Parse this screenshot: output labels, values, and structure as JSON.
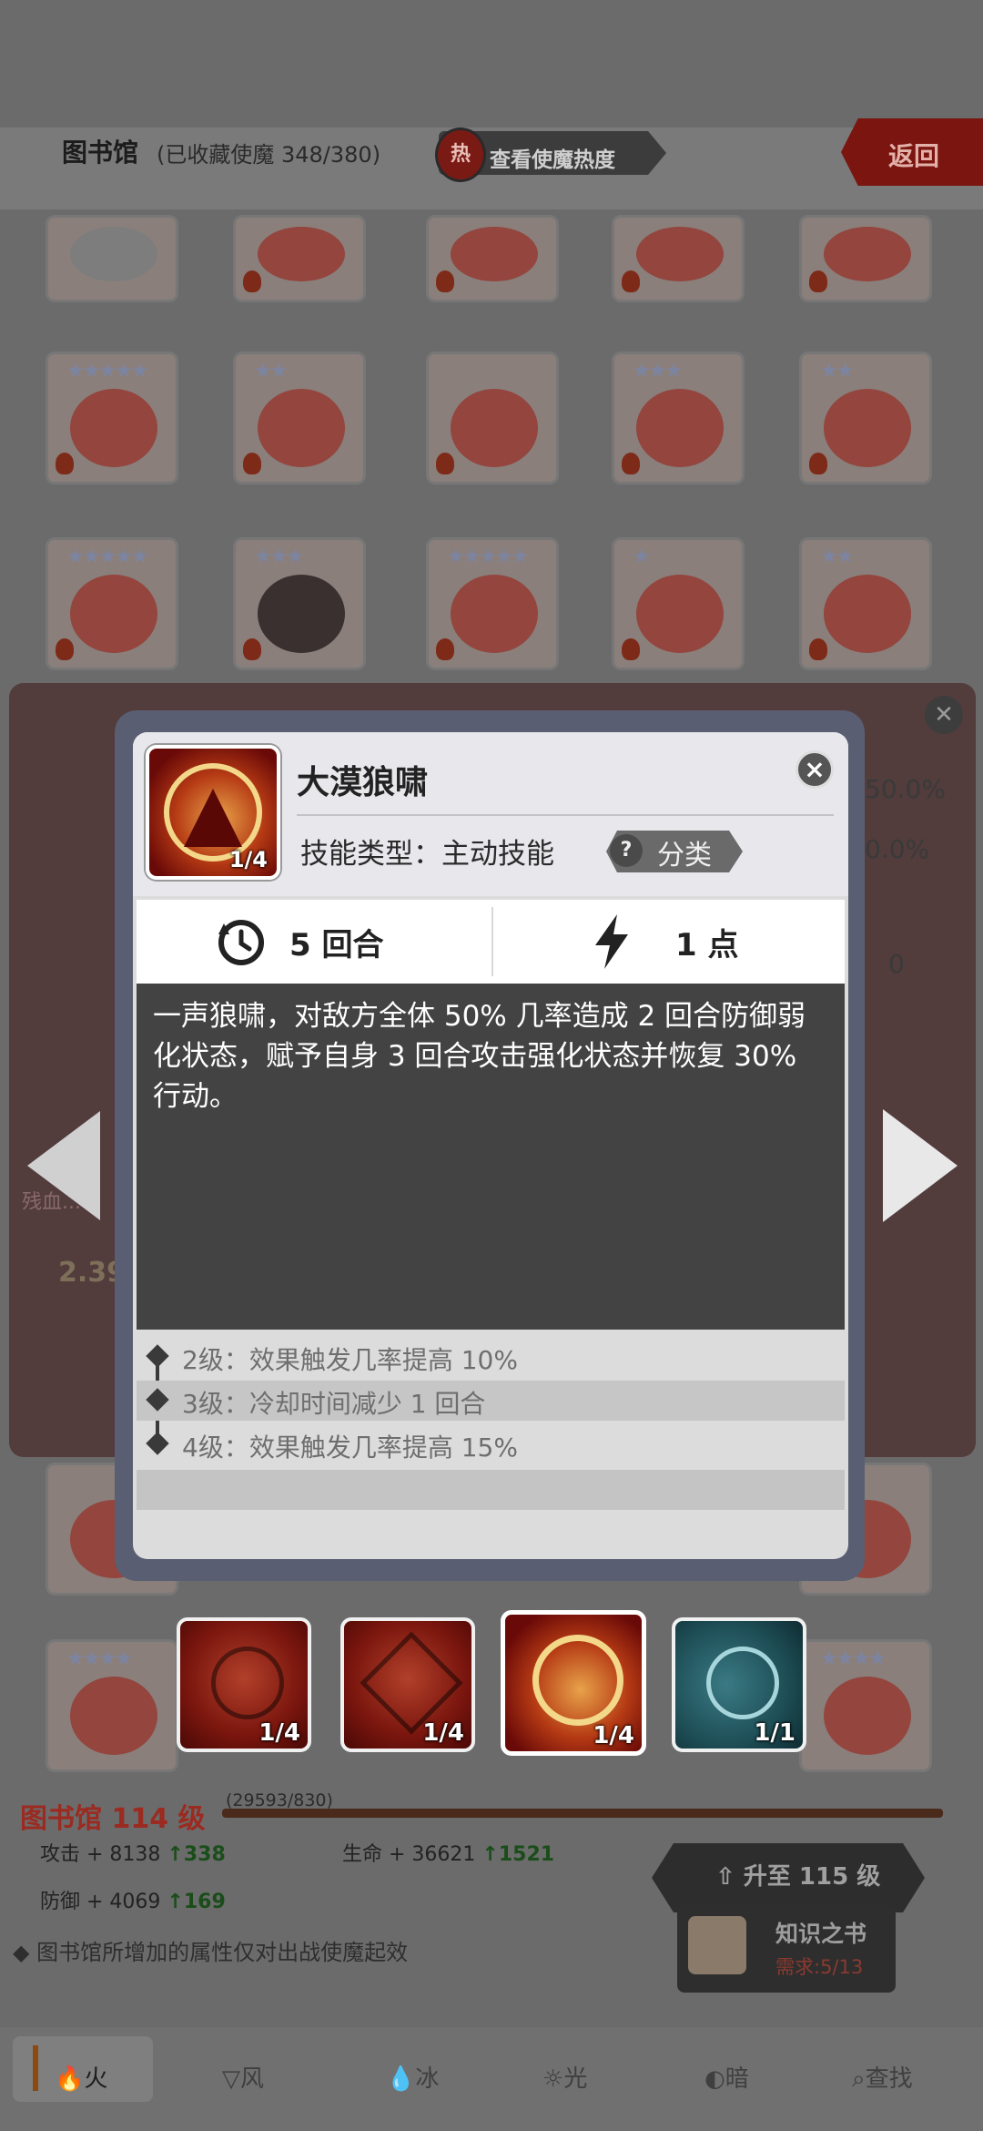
{
  "header": {
    "title": "图书馆",
    "collected": "(已收藏使魔 348/380)",
    "heat_icon": "热",
    "heat_label": "查看使魔热度",
    "back_label": "返回"
  },
  "background_panel": {
    "side_stats": [
      "50.0%",
      "0.0%",
      "0"
    ],
    "partial_label": "残血...",
    "partial_value": "2.39"
  },
  "dialog": {
    "skill_name": "大漠狼啸",
    "skill_level": "1/4",
    "type_label": "技能类型：主动技能",
    "category_label": "分类",
    "cooldown": "5 回合",
    "cost": "1 点",
    "description": "一声狼啸，对敌方全体 50% 几率造成 2 回合防御弱化状态，赋予自身 3 回合攻击强化状态并恢复 30% 行动。",
    "level_effects": [
      "2级：效果触发几率提高 10%",
      "3级：冷却时间减少 1 回合",
      "4级：效果触发几率提高 15%"
    ]
  },
  "skill_tabs": [
    {
      "level": "1/4",
      "theme": "red",
      "icon": "skull-claw-icon"
    },
    {
      "level": "1/4",
      "theme": "red",
      "icon": "burst-plus-icon"
    },
    {
      "level": "1/4",
      "theme": "gold",
      "icon": "howling-wolf-icon",
      "selected": true
    },
    {
      "level": "1/1",
      "theme": "teal",
      "icon": "wolf-plus-icon"
    }
  ],
  "library_level": {
    "label": "图书馆 114 级",
    "exp": "(29593/830)",
    "attack": "攻击 + 8138",
    "attack_inc": "338",
    "hp": "生命 + 36621",
    "hp_inc": "1521",
    "defense": "防御 + 4069",
    "defense_inc": "169",
    "upgrade_label": "升至 115 级",
    "book_title": "知识之书",
    "book_need": "需求:5/13",
    "tip": "图书馆所增加的属性仅对出战使魔起效"
  },
  "bottom_nav": [
    "火",
    "风",
    "冰",
    "光",
    "暗",
    "查找"
  ]
}
